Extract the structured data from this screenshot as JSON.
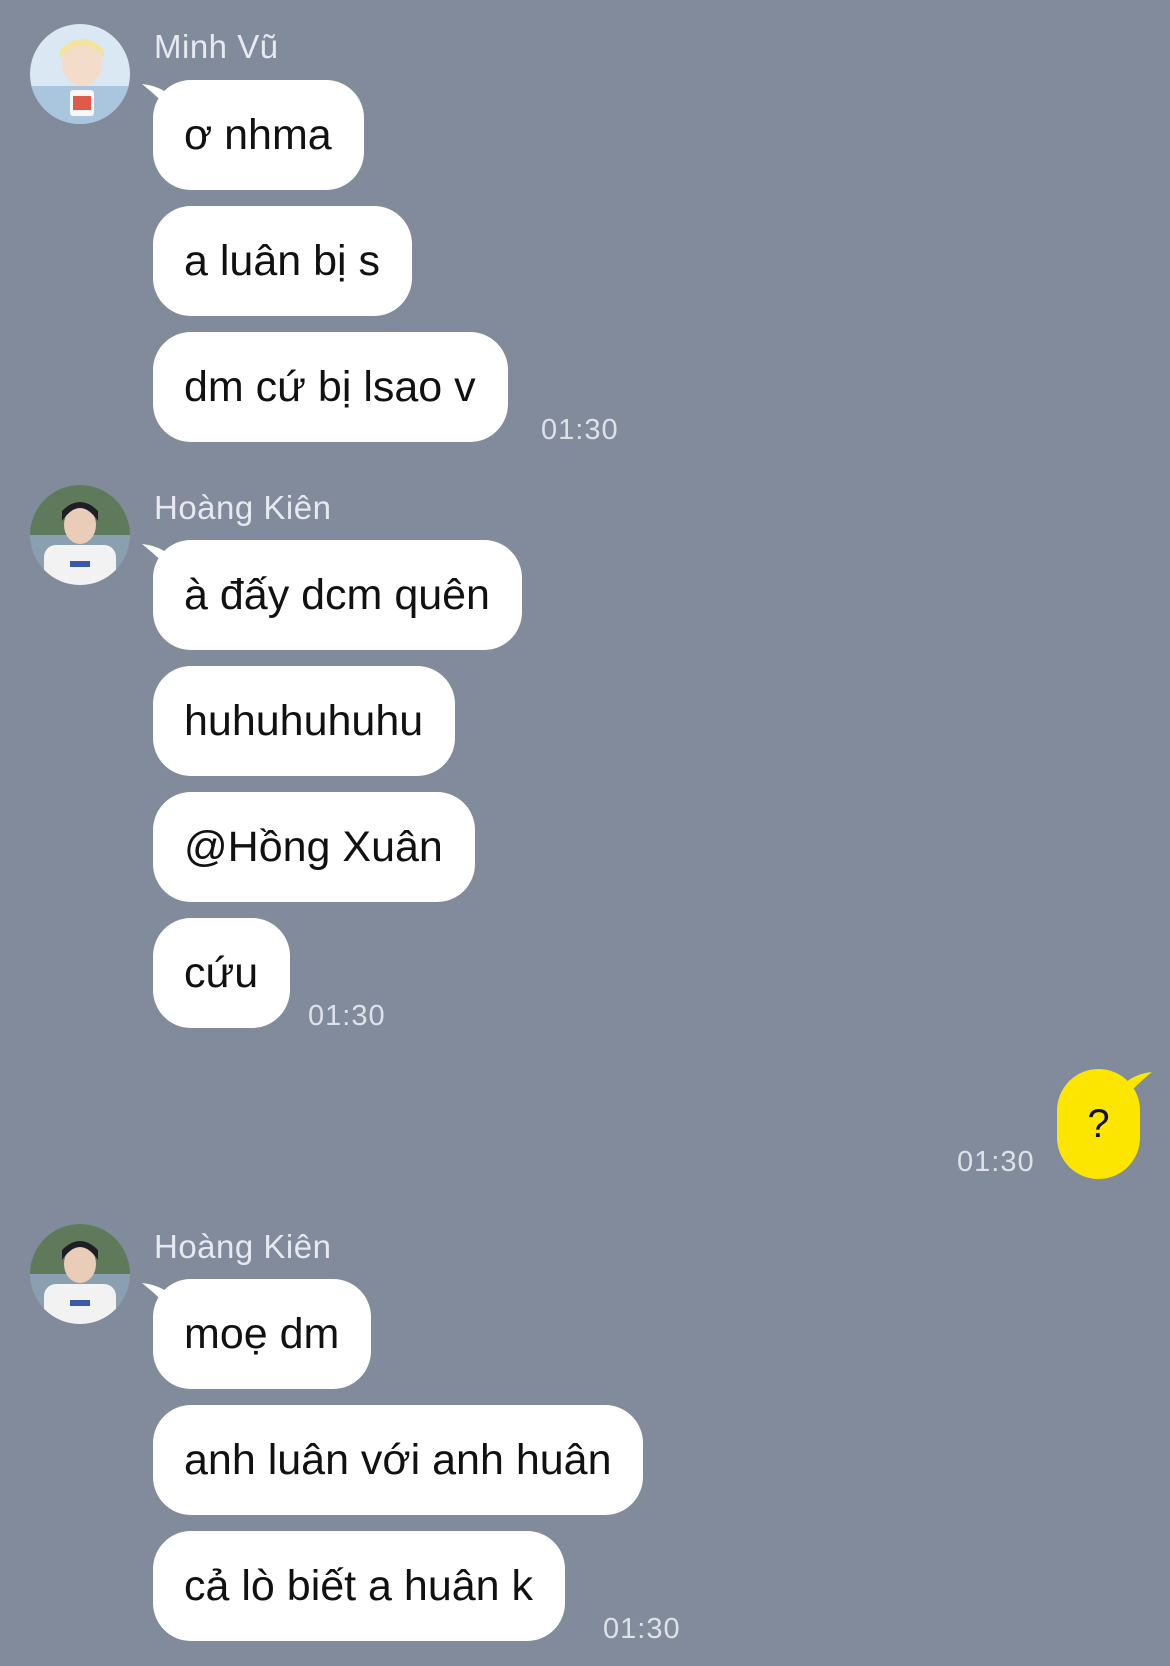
{
  "colors": {
    "background": "#828b9b",
    "incoming_bubble": "#ffffff",
    "outgoing_bubble": "#fce600"
  },
  "groups": [
    {
      "sender": "Minh Vũ",
      "avatar": "user-avatar-minh-vu",
      "messages": [
        "ơ nhma",
        "a luân bị s",
        "dm cứ bị lsao v"
      ],
      "time": "01:30"
    },
    {
      "sender": "Hoàng Kiên",
      "avatar": "user-avatar-hoang-kien",
      "messages": [
        "à đấy dcm quên",
        "huhuhuhuhu",
        "@Hồng Xuân",
        "cứu"
      ],
      "time": "01:30"
    },
    {
      "sender": "me",
      "messages": [
        "?"
      ],
      "time": "01:30"
    },
    {
      "sender": "Hoàng Kiên",
      "avatar": "user-avatar-hoang-kien",
      "messages": [
        "moẹ dm",
        "anh luân với anh huân",
        "cả lò biết a huân k"
      ],
      "time": "01:30"
    }
  ]
}
